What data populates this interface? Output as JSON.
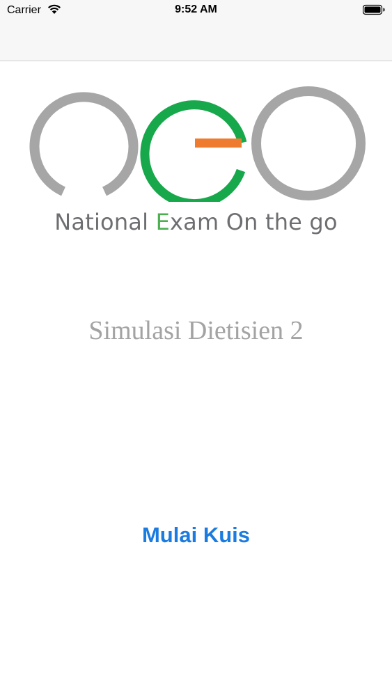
{
  "status_bar": {
    "carrier": "Carrier",
    "time": "9:52 AM",
    "wifi_icon": "wifi-icon",
    "battery_icon": "battery-full-icon"
  },
  "logo": {
    "name": "neo-logo",
    "tagline_prefix": "National ",
    "tagline_e": "E",
    "tagline_suffix": "xam On the go",
    "colors": {
      "gray": "#a6a6a6",
      "green": "#17a84b",
      "orange": "#ef7b2e"
    }
  },
  "main": {
    "quiz_title": "Simulasi Dietisien 2",
    "start_button_label": "Mulai Kuis",
    "accent_color": "#1a7be0"
  }
}
